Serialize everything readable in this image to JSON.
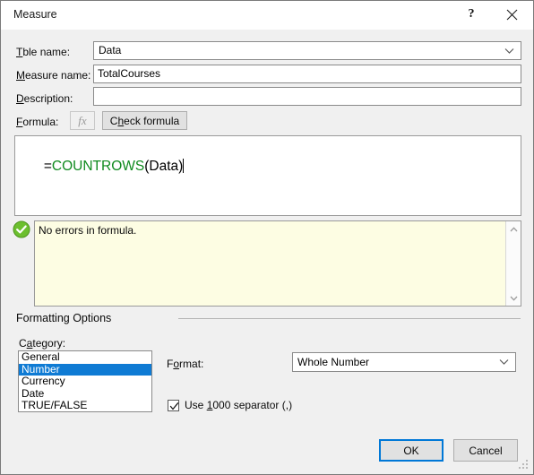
{
  "window": {
    "title": "Measure",
    "help_icon": "question-mark-icon",
    "close_icon": "close-icon"
  },
  "fields": {
    "table_name": {
      "label_pre": "T",
      "label_acc": "a",
      "label_post": "ble name:",
      "label_full": "Table name:",
      "value": "Data",
      "dropdown_icon": "chevron-down-icon"
    },
    "measure_name": {
      "label_pre": "",
      "label_acc": "M",
      "label_post": "easure name:",
      "label_full": "Measure name:",
      "value": "TotalCourses"
    },
    "description": {
      "label_pre": "",
      "label_acc": "D",
      "label_post": "escription:",
      "label_full": "Description:",
      "value": "",
      "placeholder": ""
    },
    "formula": {
      "label_pre": "",
      "label_acc": "F",
      "label_post": "ormula:",
      "label_full": "Formula:",
      "fx_button": "fx",
      "check_button_pre": "C",
      "check_button_acc": "h",
      "check_button_post": "eck formula",
      "check_button_full": "Check formula",
      "text_equals": "=",
      "text_function": "COUNTROWS",
      "text_args": "(Data)"
    }
  },
  "status": {
    "icon": "success-check-icon",
    "message": "No errors in formula.",
    "scroll_up_icon": "chevron-up-icon",
    "scroll_down_icon": "chevron-down-icon"
  },
  "formatting": {
    "group_title": "Formatting Options",
    "category": {
      "label_pre": "C",
      "label_acc": "a",
      "label_post": "tegory:",
      "label_full": "Category:",
      "options": [
        "General",
        "Number",
        "Currency",
        "Date",
        "TRUE/FALSE"
      ],
      "selected_index": 1,
      "selected": "Number"
    },
    "format": {
      "label_pre": "F",
      "label_acc": "o",
      "label_post": "rmat:",
      "label_full": "Format:",
      "value": "Whole Number",
      "dropdown_icon": "chevron-down-icon"
    },
    "separator_checkbox": {
      "checked": true,
      "text_pre": "Use ",
      "text_acc": "1",
      "text_post": "000 separator (,)",
      "text_full": "Use 1000 separator (,)"
    }
  },
  "footer": {
    "ok_label": "OK",
    "cancel_label": "Cancel"
  },
  "colors": {
    "accent_blue": "#0f7bd4",
    "function_green": "#0f8a1e",
    "status_green": "#6cbf2e",
    "message_bg": "#fdfde3",
    "dialog_bg": "#f0f0f0"
  }
}
